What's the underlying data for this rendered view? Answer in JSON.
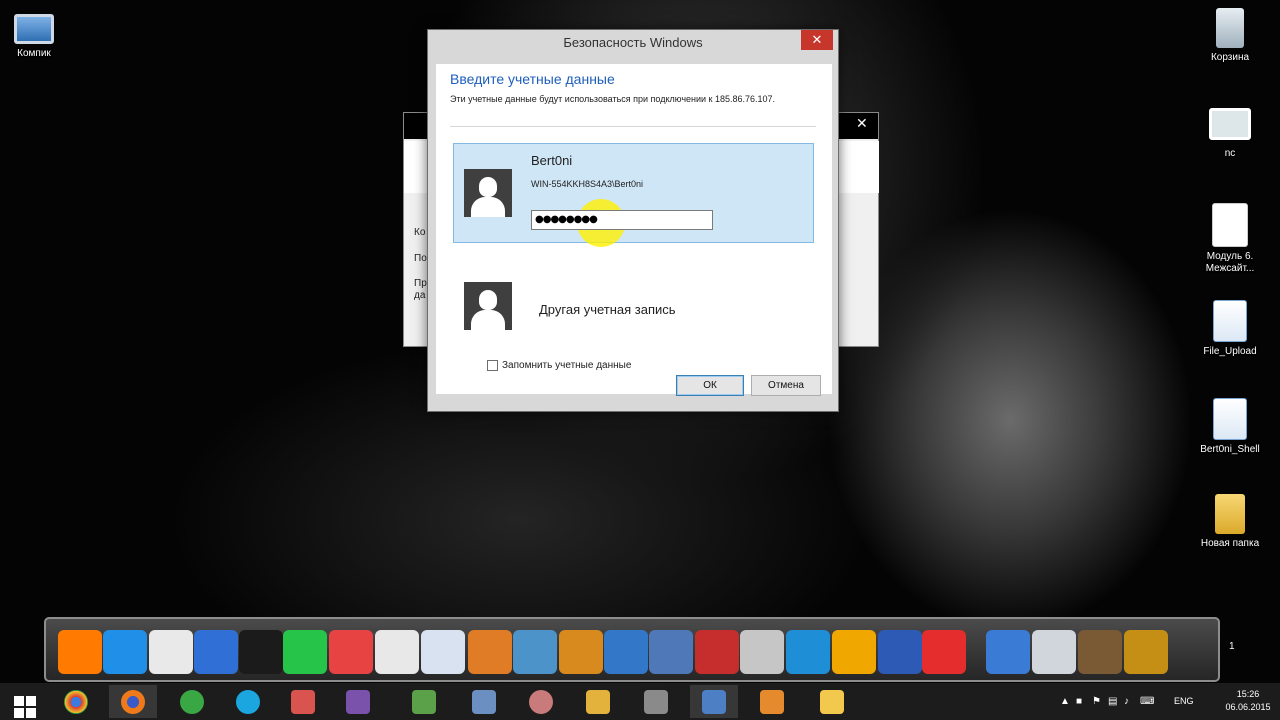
{
  "desktop": {
    "icons_left": [
      {
        "label": "Компик",
        "icon": "computer-icon"
      }
    ],
    "icons_right": [
      {
        "label": "Корзина",
        "icon": "recycle-bin-icon"
      },
      {
        "label": "nc",
        "icon": "nc-shortcut-icon"
      },
      {
        "label": "Модуль 6.\nМежсайт...",
        "icon": "document-icon"
      },
      {
        "label": "File_Upload",
        "icon": "text-document-icon"
      },
      {
        "label": "Bert0ni_Shell",
        "icon": "text-document-icon"
      },
      {
        "label": "Новая папка",
        "icon": "folder-icon"
      }
    ]
  },
  "background_window": {
    "fragments": [
      "Ко",
      "По",
      "Пр",
      "да"
    ]
  },
  "dialog": {
    "title": "Безопасность Windows",
    "close_label": "✕",
    "heading": "Введите учетные данные",
    "description": "Эти учетные данные будут использоваться при подключении к 185.86.76.107.",
    "selected_user": {
      "name": "Bert0ni",
      "domain_user": "WIN-554KKH8S4A3\\Bert0ni",
      "password_mask": "●●●●●●●●"
    },
    "other_account_label": "Другая учетная запись",
    "remember_label": "Запомнить учетные данные",
    "ok_label": "ОК",
    "cancel_label": "Отмена"
  },
  "dock": {
    "count_label": "1",
    "colors": [
      "#ff7a00",
      "#1f8fe8",
      "#e9e9e9",
      "#2f6fd6",
      "#1b1b1b",
      "#27c44a",
      "#e84343",
      "#e8e8e8",
      "#d8e2f0",
      "#e07b26",
      "#4c93c9",
      "#d98a1f",
      "#3377c8",
      "#4e78b8",
      "#c62d2d",
      "#c6c6c6",
      "#1e8fd6",
      "#f0a800",
      "#2d5ab4",
      "#e52d2d",
      "#3a7bd5",
      "#d0d6dc",
      "#7a5a34",
      "#c58f15"
    ]
  },
  "taskbar": {
    "language": "ENG",
    "time": "15:26",
    "date": "06.06.2015"
  }
}
